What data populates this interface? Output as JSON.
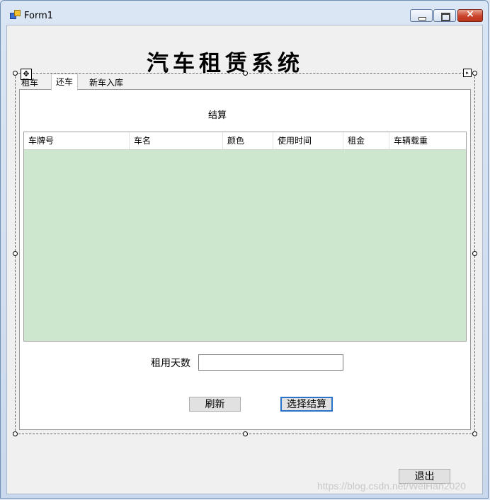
{
  "window": {
    "title": "Form1"
  },
  "form": {
    "heading": "汽车租赁系统"
  },
  "tabs": [
    {
      "label": "租车"
    },
    {
      "label": "还车"
    },
    {
      "label": "新车入库"
    }
  ],
  "return_panel": {
    "settle_label": "结算",
    "grid": {
      "columns": [
        "车牌号",
        "车名",
        "颜色",
        "使用时间",
        "租金",
        "车辆载重"
      ],
      "rows": []
    },
    "rental_days_label": "租用天数",
    "rental_days_value": "",
    "refresh_button": "刷新",
    "settle_button": "选择结算"
  },
  "exit_button": "退出",
  "designer": {
    "move_glyph": "✥",
    "smart_tag_glyph": "▸"
  },
  "watermark": "https://blog.csdn.net/WeiHan2020",
  "colors": {
    "grid_background": "#cde7cf",
    "focus_border": "#2a73c9"
  }
}
